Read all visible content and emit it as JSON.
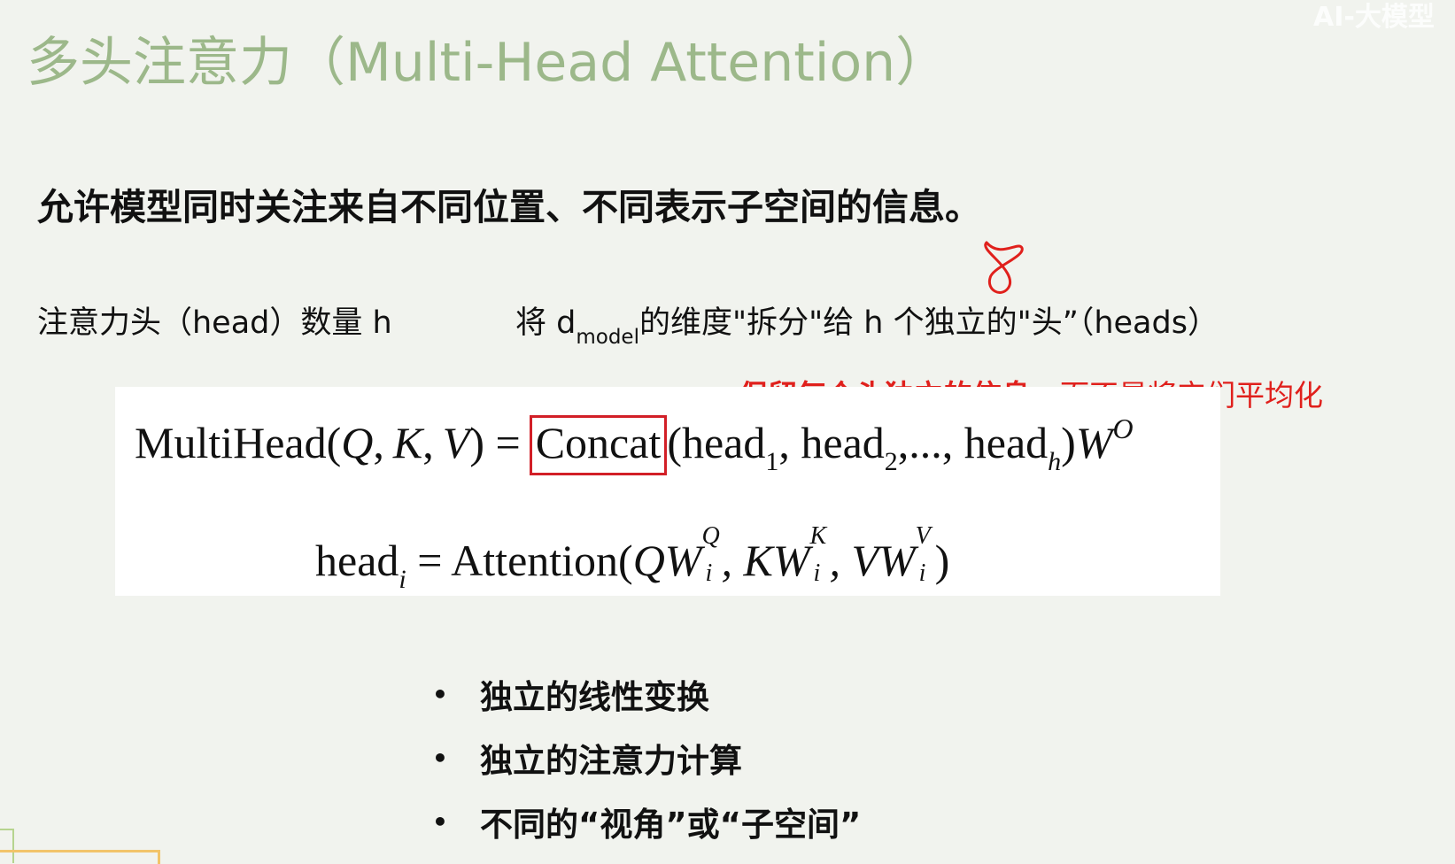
{
  "slide": {
    "title": "多头注意力（Multi-Head Attention）",
    "watermark": "AI-大模型",
    "lead": "允许模型同时关注来自不同位置、不同表示子空间的信息。",
    "head_count_label": "注意力头（head）数量 h",
    "split_prefix": "将 d",
    "split_sub": "model",
    "split_suffix": "的维度\"拆分\"给 h 个独立的\"头”（heads）",
    "annotation_strong": "保留每个头独立的信息",
    "annotation_rest": "，而不是将它们平均化",
    "colors": {
      "title": "#9cb88a",
      "annotation": "#e0201c",
      "concat_box": "#d21f27",
      "formula_bg": "#ffffff"
    }
  },
  "formula1": {
    "lhs": "MultiHead(",
    "q": "Q",
    "k": "K",
    "v": "V",
    "eq": ") =",
    "concat": "Concat",
    "open": "(head",
    "sub1": "1",
    "mid1": ", head",
    "sub2": "2",
    "mid2": ",..., head",
    "subh": "h",
    "close": ")",
    "w": "W",
    "supo": "O"
  },
  "formula2": {
    "head": "head",
    "subi": "i",
    "eq": " = Attention(",
    "qw": "QW",
    "sup_q": "Q",
    "sub_q": "i",
    "kw": ", KW",
    "sup_k": "K",
    "sub_k": "i",
    "vw": ", VW",
    "sup_v": "V",
    "sub_v": "i",
    "close": ")"
  },
  "bullets": [
    "独立的线性变换",
    "独立的注意力计算",
    "不同的“视角”或“子空间”"
  ],
  "bullet_glyph": "•"
}
